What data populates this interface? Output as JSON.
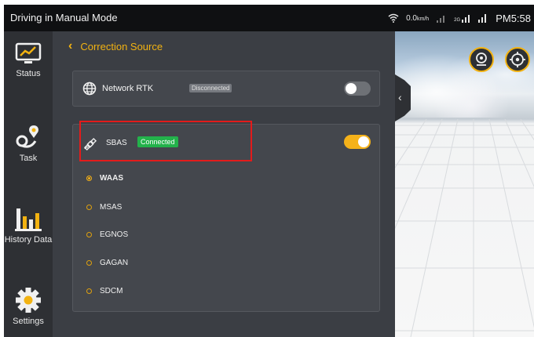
{
  "status_bar": {
    "title": "Driving in Manual Mode",
    "speed": "0.0",
    "speed_unit": "km/h",
    "signal_2g": "2G",
    "time": "PM5:58"
  },
  "sidebar": {
    "items": [
      {
        "label": "Status",
        "icon": "status-chart-icon"
      },
      {
        "label": "Task",
        "icon": "route-pin-icon"
      },
      {
        "label": "History Data",
        "icon": "bar-chart-icon"
      },
      {
        "label": "Settings",
        "icon": "gear-icon"
      }
    ]
  },
  "page": {
    "back_label": "Correction Source"
  },
  "network_rtk": {
    "label": "Network RTK",
    "status": "Disconnected",
    "enabled": false
  },
  "sbas": {
    "label": "SBAS",
    "status": "Connected",
    "enabled": true,
    "options": [
      {
        "label": "WAAS",
        "selected": true
      },
      {
        "label": "MSAS",
        "selected": false
      },
      {
        "label": "EGNOS",
        "selected": false
      },
      {
        "label": "GAGAN",
        "selected": false
      },
      {
        "label": "SDCM",
        "selected": false
      }
    ]
  },
  "colors": {
    "accent": "#f5b21a",
    "connected": "#23b24b",
    "highlight": "#e31b1b",
    "panel": "#3b3e44"
  }
}
